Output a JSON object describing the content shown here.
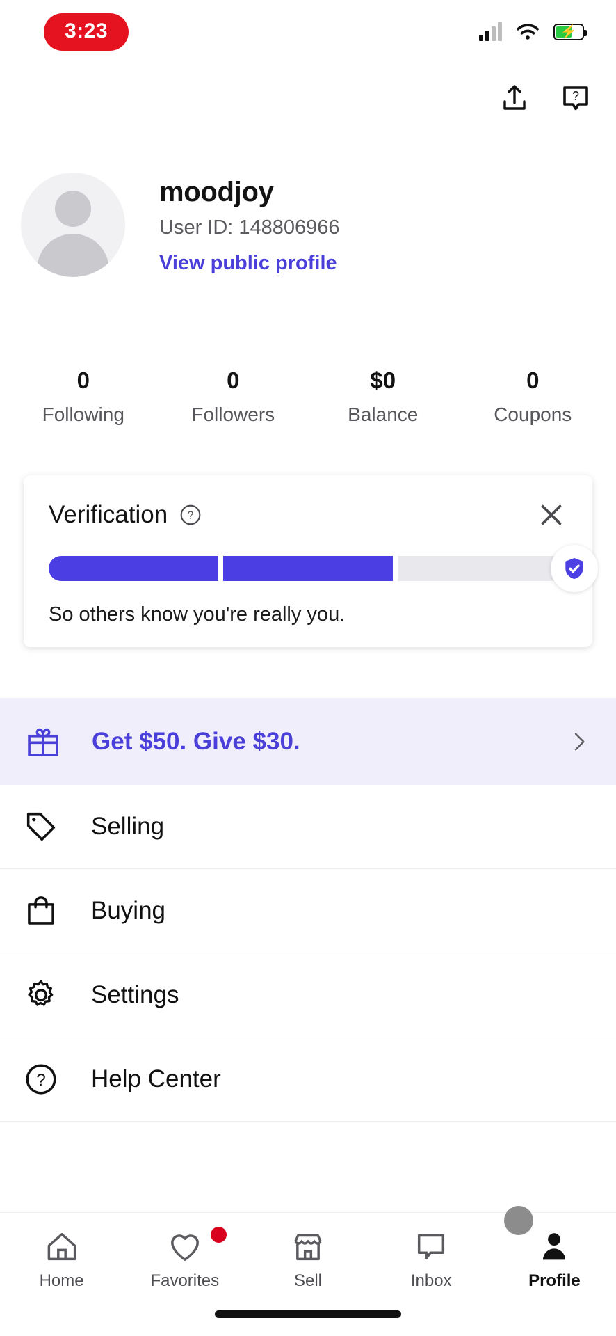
{
  "status_bar": {
    "time": "3:23",
    "cellular_icon": "cellular-bars-icon",
    "wifi_icon": "wifi-icon",
    "battery_icon": "battery-charging-icon"
  },
  "header": {
    "share_icon": "share-upload-icon",
    "help_icon": "help-chat-icon"
  },
  "profile": {
    "avatar_icon": "default-avatar-icon",
    "username": "moodjoy",
    "user_id_label": "User ID: 148806966",
    "public_profile_link": "View public profile"
  },
  "stats": [
    {
      "value": "0",
      "label": "Following"
    },
    {
      "value": "0",
      "label": "Followers"
    },
    {
      "value": "$0",
      "label": "Balance"
    },
    {
      "value": "0",
      "label": "Coupons"
    }
  ],
  "verification": {
    "title": "Verification",
    "info_icon": "question-circle-icon",
    "close_icon": "close-icon",
    "description": "So others know you're really you.",
    "shield_icon": "shield-check-icon",
    "segments_total": 3,
    "segments_filled": 2,
    "fill_color": "#4B3FE4",
    "track_color": "#E9E9ED"
  },
  "referral": {
    "icon": "gift-icon",
    "text": "Get $50. Give $30.",
    "chevron_icon": "chevron-right-icon",
    "background": "#F0EEFB",
    "text_color": "#4B3FD9"
  },
  "menu": [
    {
      "label": "Selling",
      "icon": "price-tag-icon"
    },
    {
      "label": "Buying",
      "icon": "shopping-bag-icon"
    },
    {
      "label": "Settings",
      "icon": "gear-icon"
    },
    {
      "label": "Help Center",
      "icon": "question-circle-icon"
    }
  ],
  "tabs": [
    {
      "label": "Home",
      "icon": "home-icon",
      "active": false,
      "badge": false
    },
    {
      "label": "Favorites",
      "icon": "heart-icon",
      "active": false,
      "badge": true
    },
    {
      "label": "Sell",
      "icon": "store-icon",
      "active": false,
      "badge": false
    },
    {
      "label": "Inbox",
      "icon": "chat-icon",
      "active": false,
      "badge": false
    },
    {
      "label": "Profile",
      "icon": "person-icon",
      "active": true,
      "badge": false
    }
  ]
}
